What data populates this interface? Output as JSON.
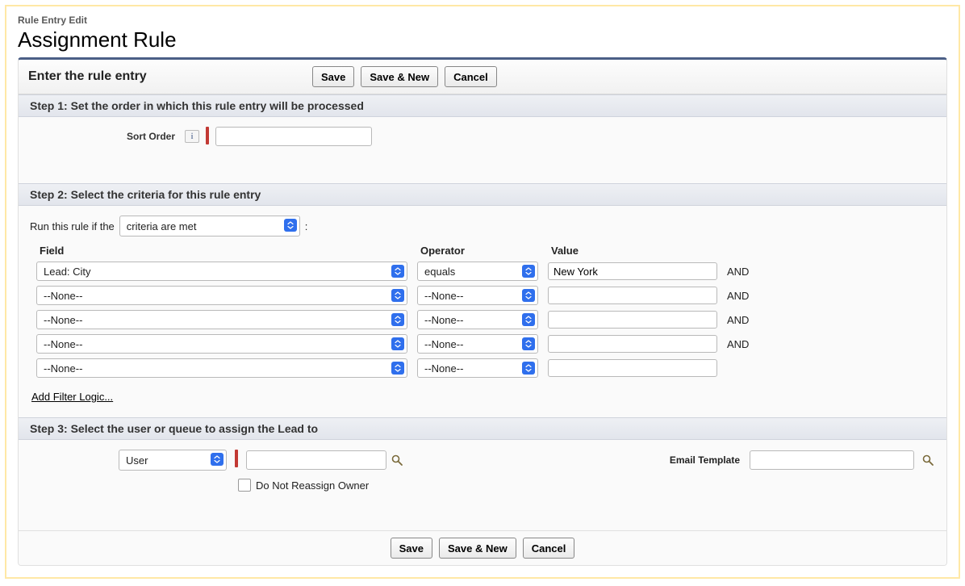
{
  "breadcrumb": "Rule Entry Edit",
  "page_title": "Assignment Rule",
  "panel": {
    "title": "Enter the rule entry",
    "buttons": {
      "save": "Save",
      "save_new": "Save & New",
      "cancel": "Cancel"
    }
  },
  "step1": {
    "header": "Step 1: Set the order in which this rule entry will be processed",
    "sort_label": "Sort Order",
    "info_glyph": "i",
    "sort_value": ""
  },
  "step2": {
    "header": "Step 2: Select the criteria for this rule entry",
    "run_prefix": "Run this rule if the",
    "run_mode": "criteria are met",
    "colon": ":",
    "columns": {
      "field": "Field",
      "operator": "Operator",
      "value": "Value"
    },
    "rows": [
      {
        "field": "Lead: City",
        "operator": "equals",
        "value": "New York",
        "logic": "AND"
      },
      {
        "field": "--None--",
        "operator": "--None--",
        "value": "",
        "logic": "AND"
      },
      {
        "field": "--None--",
        "operator": "--None--",
        "value": "",
        "logic": "AND"
      },
      {
        "field": "--None--",
        "operator": "--None--",
        "value": "",
        "logic": "AND"
      },
      {
        "field": "--None--",
        "operator": "--None--",
        "value": "",
        "logic": ""
      }
    ],
    "add_filter_logic": "Add Filter Logic..."
  },
  "step3": {
    "header": "Step 3: Select the user or queue to assign the Lead to",
    "assign_type": "User",
    "assign_value": "",
    "email_label": "Email Template",
    "email_value": "",
    "reassign_label": "Do Not Reassign Owner"
  },
  "footer_buttons": {
    "save": "Save",
    "save_new": "Save & New",
    "cancel": "Cancel"
  }
}
